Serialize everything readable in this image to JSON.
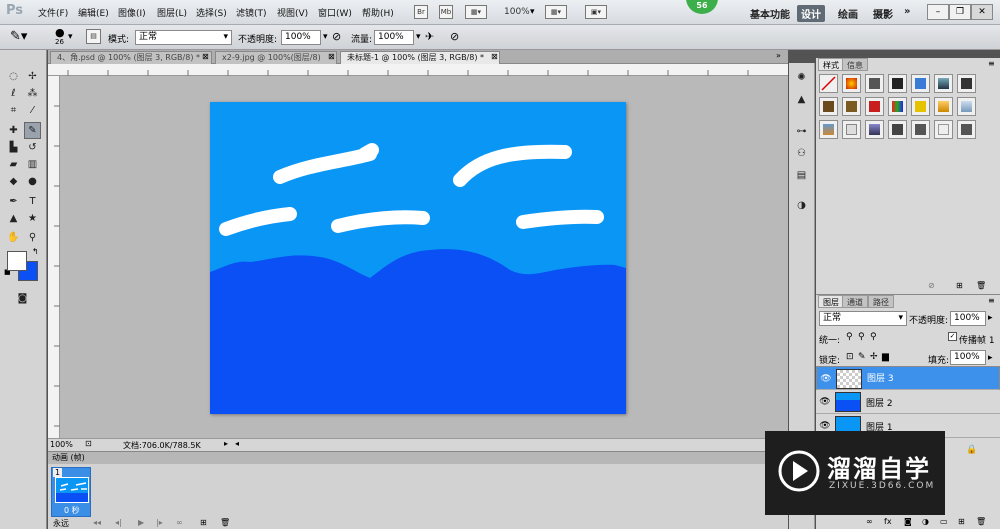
{
  "app": {
    "logo": "Ps"
  },
  "menu": [
    "文件(F)",
    "编辑(E)",
    "图像(I)",
    "图层(L)",
    "选择(S)",
    "滤镜(T)",
    "视图(V)",
    "窗口(W)",
    "帮助(H)"
  ],
  "menubar_icons": {
    "br": "Br",
    "mb": "Mb"
  },
  "zoom": "100%",
  "badge": "56",
  "workspaces": {
    "basic": "基本功能",
    "design": "设计",
    "paint": "绘画",
    "photo": "摄影",
    "more": "»"
  },
  "options": {
    "brush_size": "26",
    "mode_label": "模式:",
    "mode_value": "正常",
    "opacity_label": "不透明度:",
    "opacity_value": "100%",
    "flow_label": "流量:",
    "flow_value": "100%"
  },
  "tabs": [
    {
      "label": "4、角.psd @ 100% (图层 3, RGB/8) *"
    },
    {
      "label": "x2-9.jpg @ 100%(图层/8)"
    },
    {
      "label": "未标题-1 @ 100% (图层 3, RGB/8) *"
    }
  ],
  "status": {
    "zoom": "100%",
    "doc": "文档:706.0K/788.5K"
  },
  "animation": {
    "title": "动画 (帧)",
    "frame_number": "1",
    "frame_time": "0 秒",
    "loop": "永远"
  },
  "panels": {
    "styles_tab": "样式",
    "info_tab": "信息",
    "layers_tab": "图层",
    "channels_tab": "通道",
    "paths_tab": "路径",
    "blend_mode": "正常",
    "opacity_label": "不透明度:",
    "opacity_value": "100%",
    "unify_label": "统一:",
    "propagate_label": "传播帧 1",
    "lock_label": "锁定:",
    "fill_label": "填充:",
    "fill_value": "100%"
  },
  "layers": [
    {
      "name": "图层 3",
      "selected": true
    },
    {
      "name": "图层 2",
      "selected": false
    },
    {
      "name": "图层 1",
      "selected": false
    }
  ],
  "canvas": {
    "sky_color": "#0a96f5",
    "ground_color": "#0a50f5",
    "cloud_color": "#ffffff"
  },
  "watermark": {
    "title": "溜溜自学",
    "url": "ZIXUE.3D66.COM"
  }
}
